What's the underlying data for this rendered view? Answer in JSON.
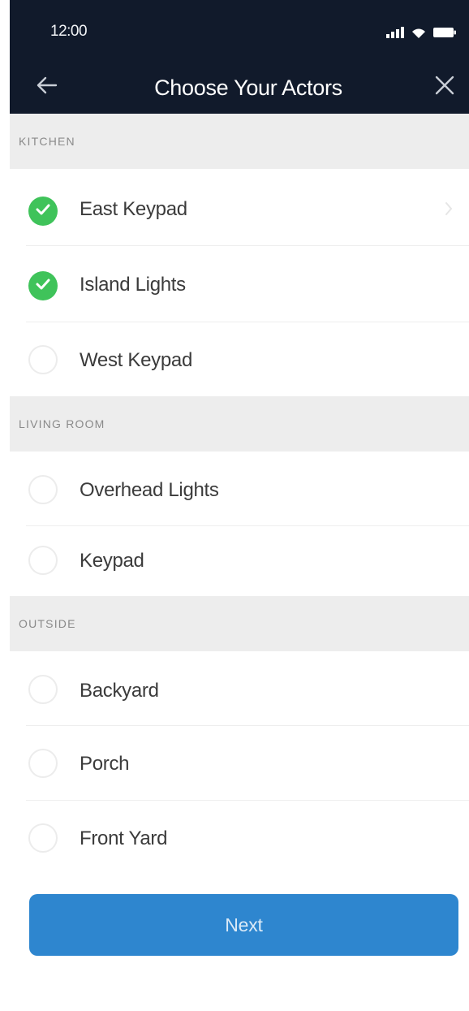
{
  "status_bar": {
    "time": "12:00",
    "icons": [
      "signal-icon",
      "wifi-icon",
      "battery-icon"
    ]
  },
  "nav": {
    "title": "Choose Your Actors",
    "back_icon": "back-arrow-icon",
    "close_icon": "close-icon"
  },
  "sections": [
    {
      "header": "KITCHEN",
      "items": [
        {
          "label": "East Keypad",
          "checked": true,
          "chevron": true
        },
        {
          "label": "Island Lights",
          "checked": true,
          "chevron": false
        },
        {
          "label": "West Keypad",
          "checked": false,
          "chevron": false
        }
      ]
    },
    {
      "header": "LIVING ROOM",
      "items": [
        {
          "label": "Overhead Lights",
          "checked": false,
          "chevron": false
        },
        {
          "label": "Keypad",
          "checked": false,
          "chevron": false
        }
      ]
    },
    {
      "header": "OUTSIDE",
      "items": [
        {
          "label": "Backyard",
          "checked": false,
          "chevron": false
        },
        {
          "label": "Porch",
          "checked": false,
          "chevron": false
        },
        {
          "label": "Front Yard",
          "checked": false,
          "chevron": false
        }
      ]
    }
  ],
  "actions": {
    "next_label": "Next"
  },
  "colors": {
    "topbar": "#111a2b",
    "checked": "#3fc35a",
    "accent": "#2e86cf",
    "section_bg": "#ededed"
  }
}
